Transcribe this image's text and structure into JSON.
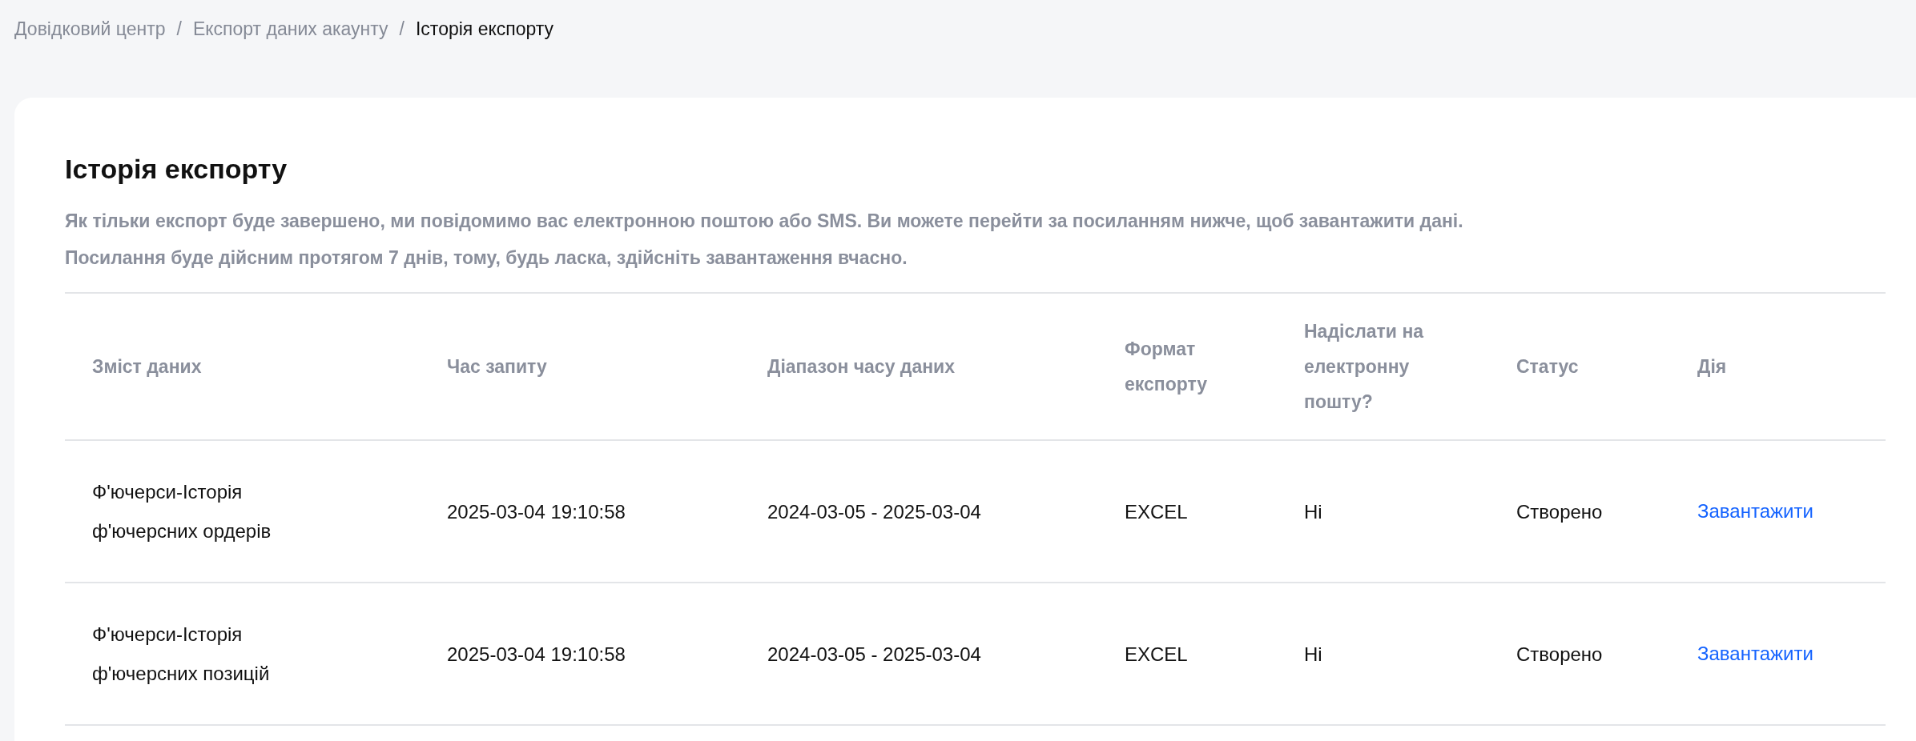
{
  "breadcrumb": [
    {
      "label": "Довідковий центр",
      "current": false
    },
    {
      "label": "Експорт даних акаунту",
      "current": false
    },
    {
      "label": "Історія експорту",
      "current": true
    }
  ],
  "breadcrumb_separator": "/",
  "title": "Історія експорту",
  "description": [
    "Як тільки експорт буде завершено, ми повідомимо вас електронною поштою або SMS. Ви можете перейти за посиланням нижче, щоб завантажити дані.",
    "Посилання буде дійсним протягом 7 днів, тому, будь ласка, здійсніть завантаження вчасно."
  ],
  "table": {
    "columns": [
      "Зміст даних",
      "Час запиту",
      "Діапазон часу даних",
      "Формат експорту",
      "Надіслати на електронну пошту?",
      "Статус",
      "Дія"
    ],
    "rows": [
      {
        "content": "Ф'ючерси-Історія ф'ючерсних ордерів",
        "request_time": "2025-03-04 19:10:58",
        "data_range": "2024-03-05 - 2025-03-04",
        "format": "EXCEL",
        "email": "Ні",
        "status": "Створено",
        "action": "Завантажити"
      },
      {
        "content": "Ф'ючерси-Історія ф'ючерсних позицій",
        "request_time": "2025-03-04 19:10:58",
        "data_range": "2024-03-05 - 2025-03-04",
        "format": "EXCEL",
        "email": "Ні",
        "status": "Створено",
        "action": "Завантажити"
      }
    ]
  }
}
